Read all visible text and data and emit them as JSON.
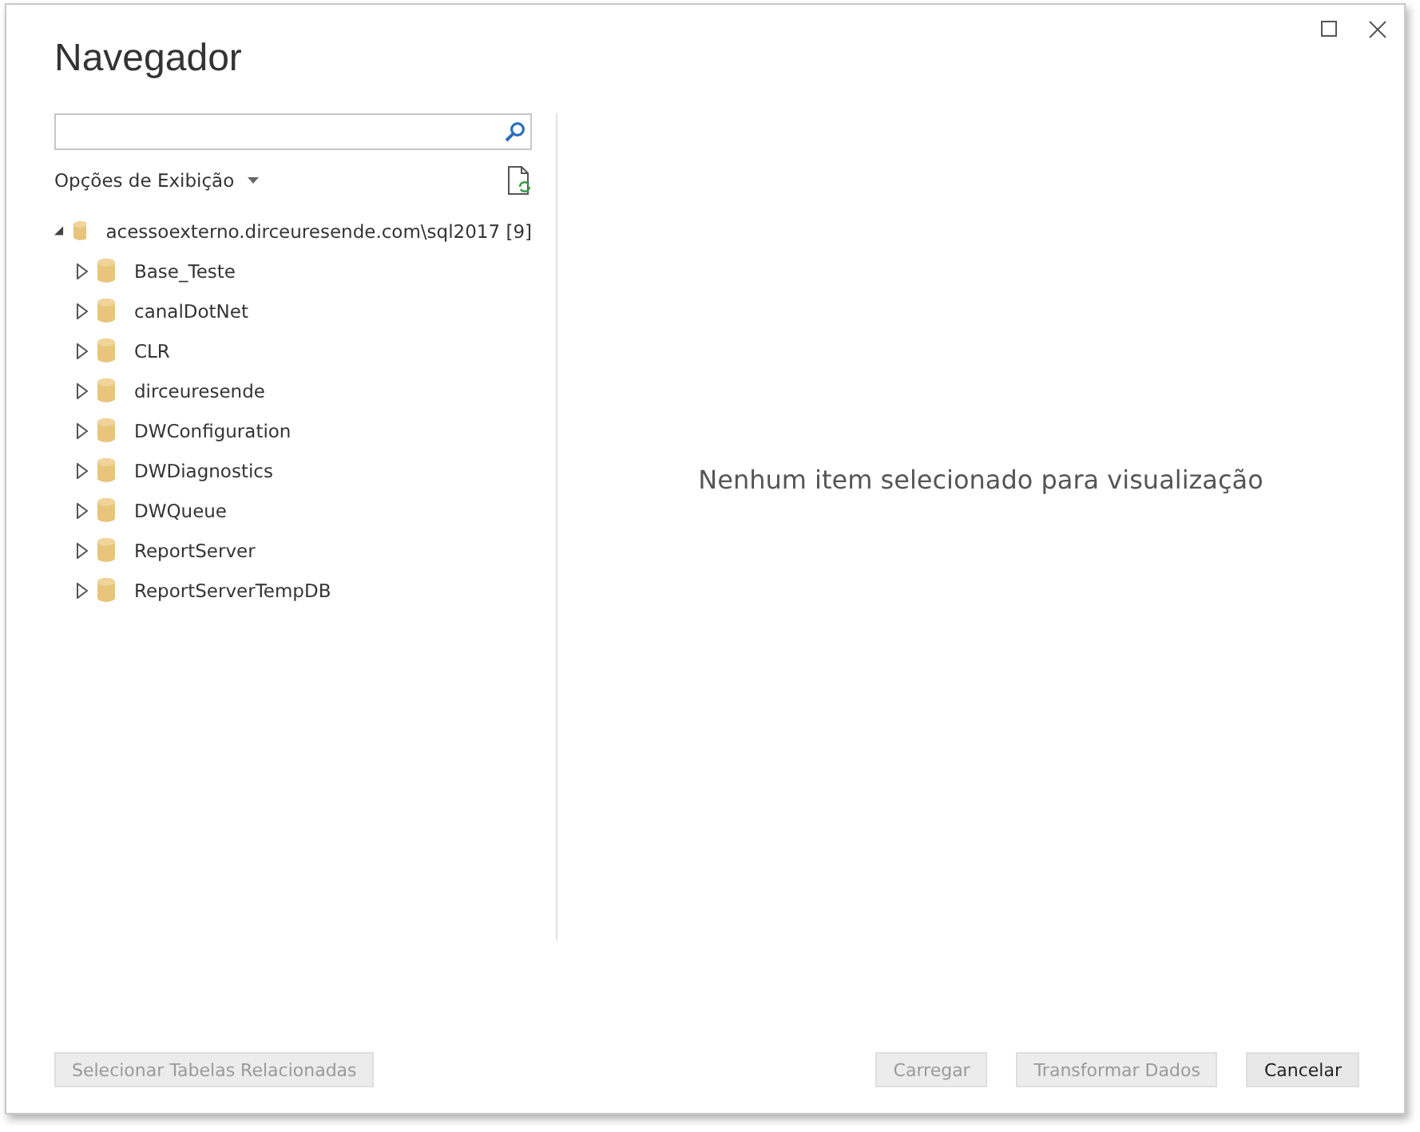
{
  "window": {
    "title": "Navegador"
  },
  "display_options": {
    "label": "Opções de Exibição"
  },
  "tree": [
    {
      "label": "acessoexterno.dirceuresende.com\\sql2017 [9]",
      "expanded": true,
      "children": [
        {
          "label": "Base_Teste",
          "expanded": false
        },
        {
          "label": "canalDotNet",
          "expanded": false
        },
        {
          "label": "CLR",
          "expanded": false
        },
        {
          "label": "dirceuresende",
          "expanded": false
        },
        {
          "label": "DWConfiguration",
          "expanded": false
        },
        {
          "label": "DWDiagnostics",
          "expanded": false
        },
        {
          "label": "DWQueue",
          "expanded": false
        },
        {
          "label": "ReportServer",
          "expanded": false
        },
        {
          "label": "ReportServerTempDB",
          "expanded": false
        }
      ]
    }
  ],
  "preview": {
    "message": "Nenhum item selecionado para visualização"
  },
  "buttons_left": [
    {
      "label": "Selecionar Tabelas Relacionadas",
      "disabled": true
    }
  ],
  "buttons_right": [
    {
      "label": "Carregar",
      "disabled": true
    },
    {
      "label": "Transformar Dados",
      "disabled": true
    },
    {
      "label": "Cancelar",
      "disabled": false
    }
  ]
}
